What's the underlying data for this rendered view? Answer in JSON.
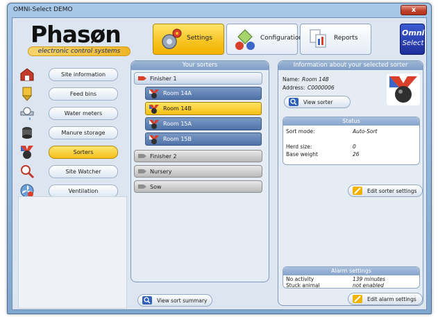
{
  "window": {
    "title": "OMNI-Select DEMO",
    "close_symbol": "x"
  },
  "logo": {
    "word": "Phasøn",
    "tagline": "electronic control systems"
  },
  "nav": {
    "tabs": [
      {
        "label": "Settings",
        "icon": "gears-icon",
        "active": true
      },
      {
        "label": "Configuration",
        "icon": "configuration-icon",
        "active": false
      },
      {
        "label": "Reports",
        "icon": "reports-icon",
        "active": false
      }
    ]
  },
  "product_logo": {
    "line1": "Omni",
    "line2": "Select"
  },
  "sidebar": {
    "items": [
      {
        "label": "Site information",
        "icon": "barn-icon",
        "active": false
      },
      {
        "label": "Feed bins",
        "icon": "feed-bin-icon",
        "active": false
      },
      {
        "label": "Water meters",
        "icon": "water-meter-icon",
        "active": false
      },
      {
        "label": "Manure storage",
        "icon": "manure-storage-icon",
        "active": false
      },
      {
        "label": "Sorters",
        "icon": "sorter-icon",
        "active": true
      },
      {
        "label": "Site Watcher",
        "icon": "site-watcher-icon",
        "active": false
      },
      {
        "label": "Ventilation",
        "icon": "ventilation-icon",
        "active": false
      }
    ]
  },
  "sorters_panel": {
    "title": "Your sorters",
    "groups": [
      {
        "label": "Finisher 1",
        "open": true,
        "rooms": [
          {
            "label": "Room 14A",
            "selected": false
          },
          {
            "label": "Room 14B",
            "selected": true
          },
          {
            "label": "Room 15A",
            "selected": false
          },
          {
            "label": "Room 15B",
            "selected": false
          }
        ]
      },
      {
        "label": "Finisher 2",
        "open": false
      },
      {
        "label": "Nursery",
        "open": false
      },
      {
        "label": "Sow",
        "open": false
      }
    ],
    "view_summary_label": "View sort summary"
  },
  "info_panel": {
    "title": "Information about your selected sorter",
    "name_label": "Name:",
    "name_value": "Room 14B",
    "address_label": "Address:",
    "address_value": "C0000006",
    "view_sorter_label": "View sorter",
    "status": {
      "title": "Status",
      "sort_mode_label": "Sort mode:",
      "sort_mode_value": "Auto-Sort",
      "herd_size_label": "Herd size:",
      "herd_size_value": "0",
      "base_weight_label": "Base weight",
      "base_weight_value": "26"
    },
    "edit_sorter_label": "Edit sorter settings",
    "alarm": {
      "title": "Alarm settings",
      "no_activity_label": "No activity",
      "no_activity_value": "139 minutes",
      "stuck_animal_label": "Stuck animal",
      "stuck_animal_value": "not enabled"
    },
    "edit_alarm_label": "Edit alarm settings"
  },
  "colors": {
    "accent_yellow": "#f6c21f",
    "panel_blue": "#7d9cc5",
    "room_blue": "#4f72a8"
  }
}
